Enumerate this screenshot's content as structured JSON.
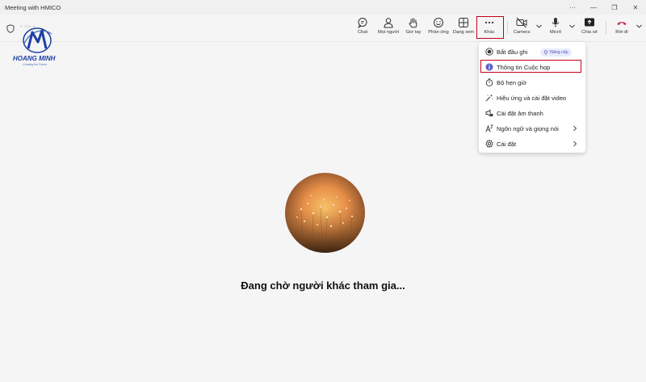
{
  "window": {
    "title": "Meeting with HMICO",
    "controls": [
      "···",
      "—",
      "❐",
      "✕"
    ]
  },
  "meeting": {
    "timer": "- -:- -"
  },
  "toolbar": {
    "chat": "Chat",
    "people": "Mọi người",
    "raise_hand": "Giơ tay",
    "reactions": "Phản ứng",
    "view": "Dạng xem",
    "more": "Khác",
    "camera": "Camera",
    "mic": "Micrô",
    "share": "Chia sẻ",
    "leave": "Rời đi"
  },
  "logo": {
    "brand": "HOANG MINH",
    "slogan": "Creating the Future"
  },
  "more_menu": {
    "items": [
      {
        "label": "Bắt đầu ghi",
        "icon": "record-icon",
        "badge": "Nâng cấp"
      },
      {
        "label": "Thông tin Cuộc họp",
        "icon": "info-icon"
      },
      {
        "label": "Bộ hẹn giờ",
        "icon": "timer-icon"
      },
      {
        "label": "Hiệu ứng và cài đặt video",
        "icon": "magic-wand-icon"
      },
      {
        "label": "Cài đặt âm thanh",
        "icon": "speaker-icon"
      },
      {
        "label": "Ngôn ngữ và giọng nói",
        "icon": "language-icon",
        "submenu": true
      },
      {
        "label": "Cài đặt",
        "icon": "gear-icon",
        "submenu": true
      }
    ]
  },
  "status": {
    "waiting": "Đang chờ người khác tham gia..."
  },
  "colors": {
    "highlight": "#c4001a",
    "leave": "#c4314b",
    "accent": "#5b5fc7",
    "brand": "#1c3fa3"
  }
}
